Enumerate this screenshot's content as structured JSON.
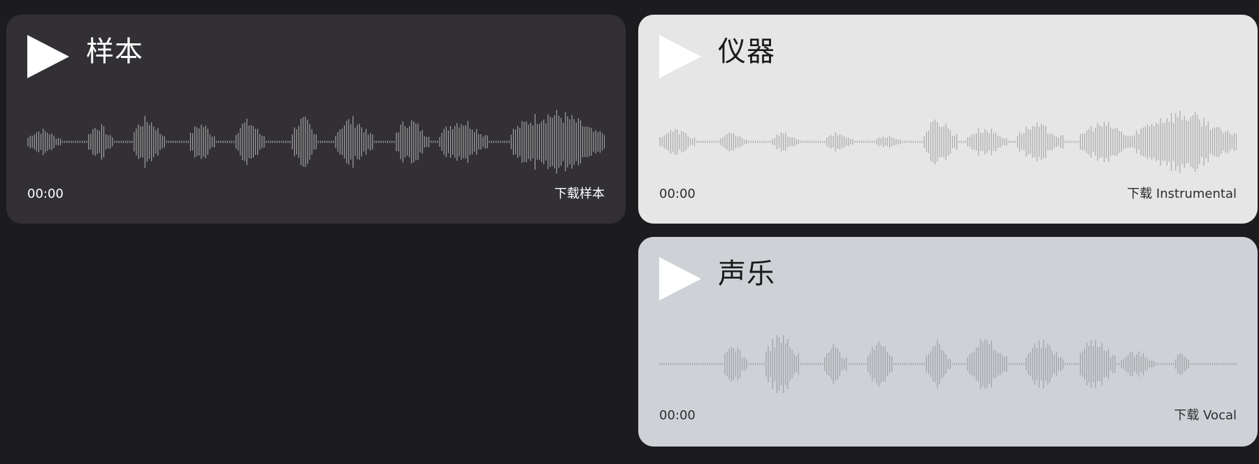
{
  "tracks": [
    {
      "title": "样本",
      "time": "00:00",
      "download_label": "下载样本",
      "play_icon": "play-icon",
      "waveform_color": "#a3a3a3"
    },
    {
      "title": "仪器",
      "time": "00:00",
      "download_label": "下载 Instrumental",
      "play_icon": "play-icon",
      "waveform_color": "#a8a8a8"
    },
    {
      "title": "声乐",
      "time": "00:00",
      "download_label": "下载 Vocal",
      "play_icon": "play-icon",
      "waveform_color": "#9d9fa3"
    }
  ],
  "colors": {
    "page_background": "#1c1b1e",
    "sample_card": "#323034",
    "instrumental_card": "#e6e6e6",
    "vocal_card": "#ced2d6",
    "play_icon": "#ffffff"
  }
}
